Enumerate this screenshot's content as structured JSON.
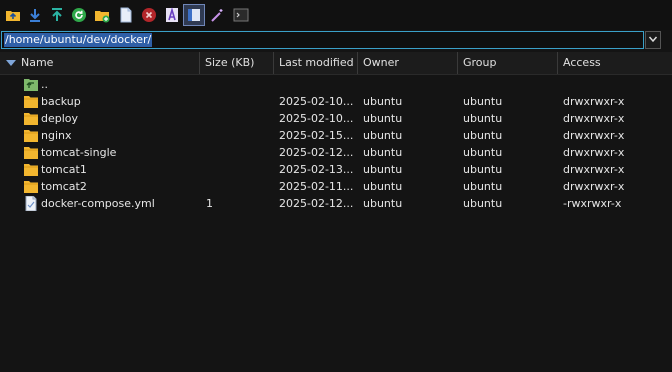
{
  "toolbar": {
    "buttons": [
      {
        "id": "parent-dir",
        "icon": "folder-up-icon"
      },
      {
        "id": "download",
        "icon": "download-icon"
      },
      {
        "id": "upload",
        "icon": "upload-icon"
      },
      {
        "id": "refresh",
        "icon": "refresh-icon"
      },
      {
        "id": "new-folder",
        "icon": "new-folder-icon"
      },
      {
        "id": "new-file",
        "icon": "new-file-icon"
      },
      {
        "id": "delete",
        "icon": "delete-icon"
      },
      {
        "id": "rename",
        "icon": "rename-icon"
      },
      {
        "id": "toggle-view",
        "icon": "view-toggle-icon",
        "active": true
      },
      {
        "id": "wand",
        "icon": "wand-icon"
      },
      {
        "id": "terminal",
        "icon": "terminal-icon"
      }
    ]
  },
  "path": {
    "value": "/home/ubuntu/dev/docker/"
  },
  "columns": {
    "name": "Name",
    "size": "Size (KB)",
    "modified": "Last modified",
    "owner": "Owner",
    "group": "Group",
    "access": "Access"
  },
  "files": [
    {
      "type": "parent",
      "name": "..",
      "size": "",
      "modified": "",
      "owner": "",
      "group": "",
      "access": ""
    },
    {
      "type": "folder",
      "name": "backup",
      "size": "",
      "modified": "2025-02-10...",
      "owner": "ubuntu",
      "group": "ubuntu",
      "access": "drwxrwxr-x"
    },
    {
      "type": "folder",
      "name": "deploy",
      "size": "",
      "modified": "2025-02-10...",
      "owner": "ubuntu",
      "group": "ubuntu",
      "access": "drwxrwxr-x"
    },
    {
      "type": "folder",
      "name": "nginx",
      "size": "",
      "modified": "2025-02-15...",
      "owner": "ubuntu",
      "group": "ubuntu",
      "access": "drwxrwxr-x"
    },
    {
      "type": "folder",
      "name": "tomcat-single",
      "size": "",
      "modified": "2025-02-12...",
      "owner": "ubuntu",
      "group": "ubuntu",
      "access": "drwxrwxr-x"
    },
    {
      "type": "folder",
      "name": "tomcat1",
      "size": "",
      "modified": "2025-02-13...",
      "owner": "ubuntu",
      "group": "ubuntu",
      "access": "drwxrwxr-x"
    },
    {
      "type": "folder",
      "name": "tomcat2",
      "size": "",
      "modified": "2025-02-11...",
      "owner": "ubuntu",
      "group": "ubuntu",
      "access": "drwxrwxr-x"
    },
    {
      "type": "file",
      "name": "docker-compose.yml",
      "size": "1",
      "modified": "2025-02-12...",
      "owner": "ubuntu",
      "group": "ubuntu",
      "access": "-rwxrwxr-x"
    }
  ],
  "colors": {
    "accent": "#3aa0c8",
    "selection": "#2f5fa7",
    "folder": "#f2b62f"
  }
}
